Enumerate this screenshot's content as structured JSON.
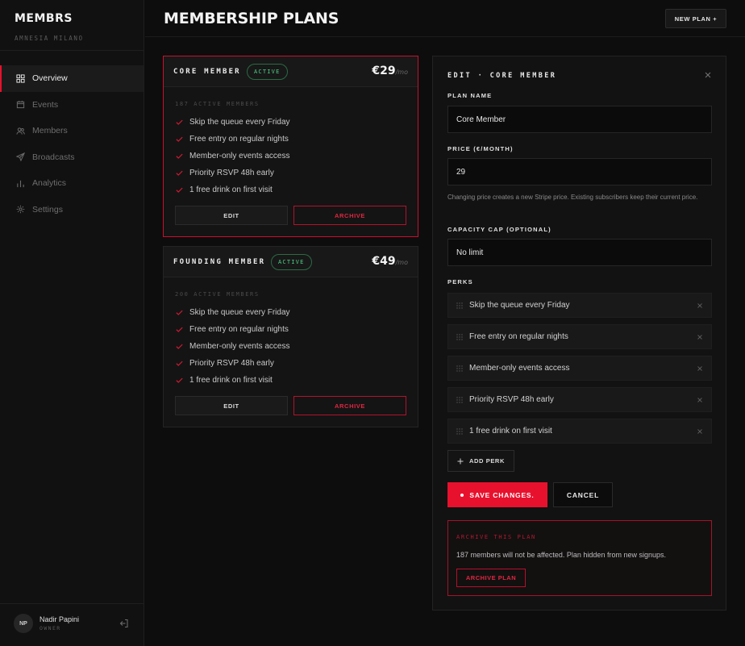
{
  "sidebar": {
    "brand": "MEMBRS",
    "venue": "AMNESIA MILANO",
    "nav": [
      {
        "label": "Overview",
        "icon": "grid-icon",
        "active": true
      },
      {
        "label": "Events",
        "icon": "calendar-icon"
      },
      {
        "label": "Members",
        "icon": "users-icon"
      },
      {
        "label": "Broadcasts",
        "icon": "send-icon"
      },
      {
        "label": "Analytics",
        "icon": "bar-chart-icon"
      },
      {
        "label": "Settings",
        "icon": "gear-icon"
      }
    ],
    "user": {
      "initials": "NP",
      "name": "Nadir Papini",
      "role": "OWNER",
      "logout_icon": "logout-icon"
    }
  },
  "header": {
    "title": "MEMBERSHIP PLANS",
    "new_plan_label": "NEW PLAN +"
  },
  "plans": [
    {
      "name": "CORE MEMBER",
      "status": "ACTIVE",
      "price": "€29",
      "period": "/mo",
      "members": "187 ACTIVE MEMBERS",
      "perks": [
        "Skip the queue every Friday",
        "Free entry on regular nights",
        "Member-only events access",
        "Priority RSVP 48h early",
        "1 free drink on first visit"
      ],
      "edit_label": "EDIT",
      "archive_label": "ARCHIVE"
    },
    {
      "name": "FOUNDING MEMBER",
      "status": "ACTIVE",
      "price": "€49",
      "period": "/mo",
      "members": "200 ACTIVE MEMBERS",
      "perks": [
        "Skip the queue every Friday",
        "Free entry on regular nights",
        "Member-only events access",
        "Priority RSVP 48h early",
        "1 free drink on first visit"
      ],
      "edit_label": "EDIT",
      "archive_label": "ARCHIVE"
    }
  ],
  "editor": {
    "title": "EDIT · CORE MEMBER",
    "plan_name_label": "PLAN NAME",
    "plan_name_value": "Core Member",
    "price_label": "PRICE (€/MONTH)",
    "price_value": "29",
    "price_hint": "Changing price creates a new Stripe price. Existing subscribers keep their current price.",
    "capacity_label": "CAPACITY CAP (OPTIONAL)",
    "capacity_value": "No limit",
    "perks_label": "PERKS",
    "perks": [
      "Skip the queue every Friday",
      "Free entry on regular nights",
      "Member-only events access",
      "Priority RSVP 48h early",
      "1 free drink on first visit"
    ],
    "add_perk_label": "ADD PERK",
    "save_label": "SAVE CHANGES.",
    "cancel_label": "CANCEL",
    "archive_title": "ARCHIVE THIS PLAN",
    "archive_text": "187 members will not be affected. Plan hidden from new signups.",
    "archive_button": "ARCHIVE PLAN"
  },
  "colors": {
    "accent": "#e8112d",
    "active_badge": "#4fd188",
    "background": "#0d0d0d"
  }
}
